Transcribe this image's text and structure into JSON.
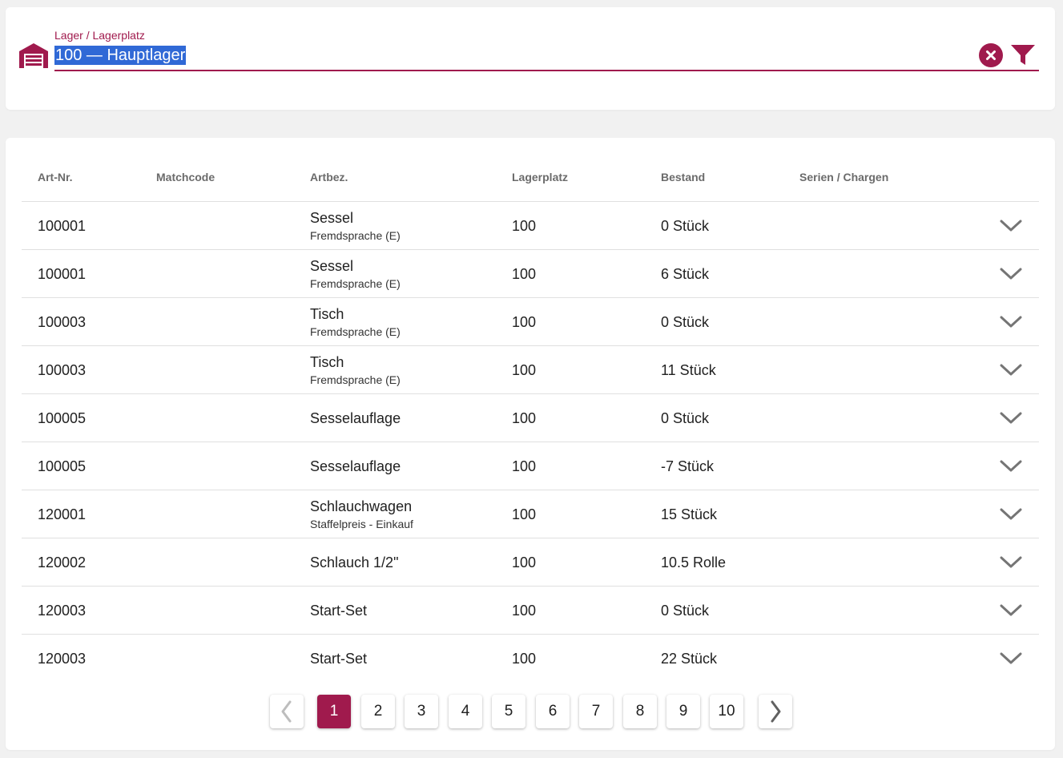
{
  "warehouse": {
    "label": "Lager / Lagerplatz",
    "value": "100 — Hauptlager",
    "icon": "warehouse-icon",
    "clear_icon": "clear-icon",
    "filter_icon": "filter-icon",
    "accent_color": "#a01a4d",
    "selection_color": "#3069d6"
  },
  "table": {
    "columns": [
      "Art-Nr.",
      "Matchcode",
      "Artbez.",
      "Lagerplatz",
      "Bestand",
      "Serien / Chargen"
    ],
    "rows": [
      {
        "art": "100001",
        "match": "",
        "bez": "Sessel",
        "sub": "Fremdsprache (E)",
        "lp": "100",
        "best": "0 Stück",
        "ser": ""
      },
      {
        "art": "100001",
        "match": "",
        "bez": "Sessel",
        "sub": "Fremdsprache (E)",
        "lp": "100",
        "best": "6 Stück",
        "ser": ""
      },
      {
        "art": "100003",
        "match": "",
        "bez": "Tisch",
        "sub": "Fremdsprache (E)",
        "lp": "100",
        "best": "0 Stück",
        "ser": ""
      },
      {
        "art": "100003",
        "match": "",
        "bez": "Tisch",
        "sub": "Fremdsprache (E)",
        "lp": "100",
        "best": "11 Stück",
        "ser": ""
      },
      {
        "art": "100005",
        "match": "",
        "bez": "Sesselauflage",
        "sub": "",
        "lp": "100",
        "best": "0 Stück",
        "ser": ""
      },
      {
        "art": "100005",
        "match": "",
        "bez": "Sesselauflage",
        "sub": "",
        "lp": "100",
        "best": "-7 Stück",
        "ser": ""
      },
      {
        "art": "120001",
        "match": "",
        "bez": "Schlauchwagen",
        "sub": "Staffelpreis - Einkauf",
        "lp": "100",
        "best": "15 Stück",
        "ser": ""
      },
      {
        "art": "120002",
        "match": "",
        "bez": "Schlauch 1/2\"",
        "sub": "",
        "lp": "100",
        "best": "10.5 Rolle",
        "ser": ""
      },
      {
        "art": "120003",
        "match": "",
        "bez": "Start-Set",
        "sub": "",
        "lp": "100",
        "best": "0 Stück",
        "ser": ""
      },
      {
        "art": "120003",
        "match": "",
        "bez": "Start-Set",
        "sub": "",
        "lp": "100",
        "best": "22 Stück",
        "ser": ""
      }
    ],
    "expand_icon": "chevron-down-icon"
  },
  "pagination": {
    "pages": [
      "1",
      "2",
      "3",
      "4",
      "5",
      "6",
      "7",
      "8",
      "9",
      "10"
    ],
    "active": "1",
    "prev_icon": "chevron-left-icon",
    "next_icon": "chevron-right-icon"
  }
}
